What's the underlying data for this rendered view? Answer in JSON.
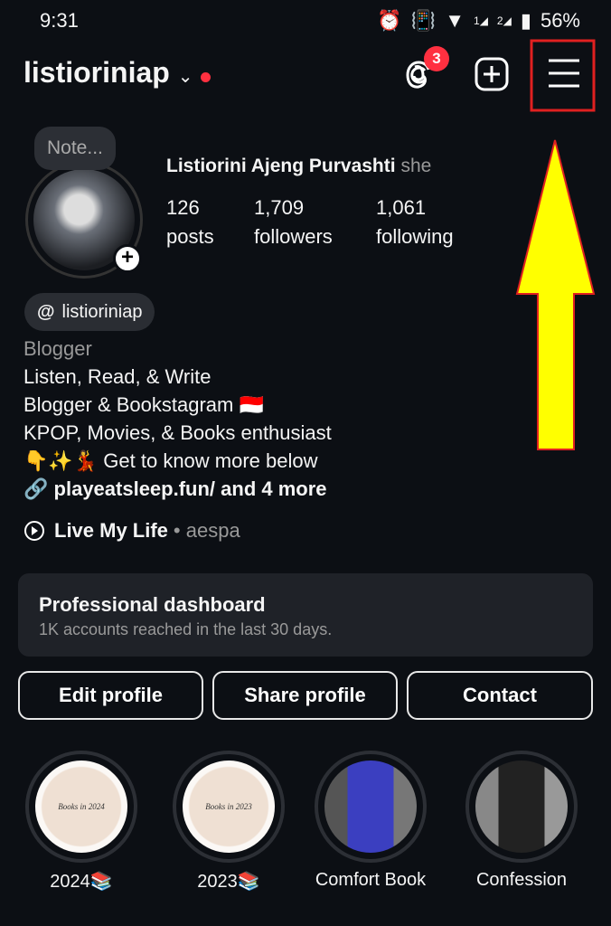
{
  "status_bar": {
    "time": "9:31",
    "battery": "56%",
    "sim1": "1",
    "sim2": "2"
  },
  "header": {
    "username": "listioriniap",
    "threads_badge": "3"
  },
  "profile": {
    "note": "Note...",
    "full_name": "Listiorini Ajeng Purvashti",
    "pronouns": "she",
    "stats": [
      {
        "value": "126",
        "label": "posts"
      },
      {
        "value": "1,709",
        "label": "followers"
      },
      {
        "value": "1,061",
        "label": "following"
      }
    ],
    "threads_handle": "listioriniap",
    "category": "Blogger",
    "bio": [
      "Listen, Read, & Write",
      "Blogger & Bookstagram 🇮🇩",
      "KPOP, Movies, & Books enthusiast",
      "👇✨💃 Get to know more below"
    ],
    "link": "playeatsleep.fun/ and 4 more",
    "music": {
      "song": "Live My Life",
      "artist": "• aespa"
    }
  },
  "dashboard": {
    "title": "Professional dashboard",
    "subtitle": "1K accounts reached in the last 30 days."
  },
  "buttons": {
    "edit": "Edit profile",
    "share": "Share profile",
    "contact": "Contact"
  },
  "highlights": [
    {
      "label": "2024📚",
      "cover_text": "Books in 2024"
    },
    {
      "label": "2023📚",
      "cover_text": "Books in 2023"
    },
    {
      "label": "Comfort Book"
    },
    {
      "label": "Confession"
    }
  ],
  "annotation": {
    "color": "#e02020",
    "arrow_color": "#ffff00"
  }
}
